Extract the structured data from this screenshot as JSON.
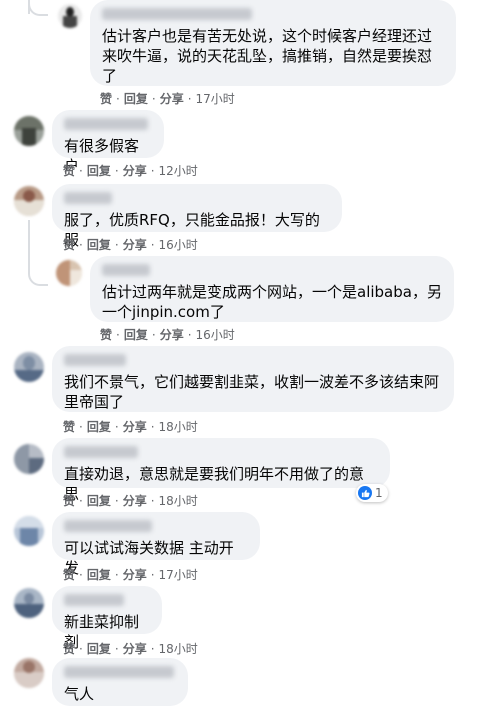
{
  "labels": {
    "like": "赞",
    "reply": "回复",
    "share": "分享",
    "sep": "·"
  },
  "comments": [
    {
      "text": "估计客户也是有苦无处说，这个时候客户经理还过来吹牛逼，说的天花乱坠，搞推销，自然是要挨怼了",
      "time": "17小时",
      "reply": true
    },
    {
      "text": "有很多假客户",
      "time": "12小时",
      "reply": false
    },
    {
      "text": "服了，优质RFQ，只能金品报！大写的服",
      "time": "16小时",
      "reply": false
    },
    {
      "text": "估计过两年就是变成两个网站，一个是alibaba，另一个jinpin.com了",
      "time": "16小时",
      "reply": true
    },
    {
      "text": "我们不景气，它们越要割韭菜，收割一波差不多该结束阿里帝国了",
      "time": "18小时",
      "reply": false
    },
    {
      "text": "直接劝退，意思就是要我们明年不用做了的意思",
      "time": "18小时",
      "reply": false,
      "reactions": "1"
    },
    {
      "text": "可以试试海关数据 主动开发",
      "time": "17小时",
      "reply": false
    },
    {
      "text": "新韭菜抑制剂",
      "time": "18小时",
      "reply": false
    },
    {
      "text": "气人",
      "time": "",
      "reply": false
    }
  ],
  "colors": {
    "bubble": "#f0f2f5",
    "meta": "#65676b",
    "like_blue": "#1877f2"
  }
}
